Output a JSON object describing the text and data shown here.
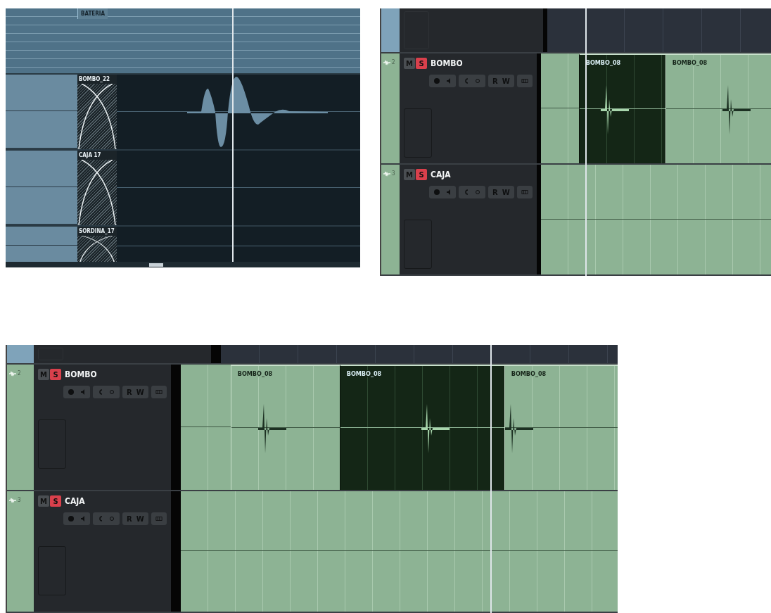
{
  "panels": [
    {
      "kind": "folder",
      "folder": {
        "label": "BATERIA"
      },
      "lanes": [
        {
          "label": "BOMBO_22",
          "waveform": true
        },
        {
          "label": "CAJA 17",
          "waveform": false
        },
        {
          "label": "SORDINA_17",
          "waveform": false
        }
      ]
    },
    {
      "kind": "tracks",
      "tracks": [
        {
          "number": "2",
          "mute": {
            "label": "M",
            "on": false
          },
          "solo": {
            "label": "S",
            "on": true
          },
          "name": "BOMBO",
          "read": "R",
          "write": "W",
          "clips": [
            {
              "label": "BOMBO_08",
              "selected": true
            },
            {
              "label": "BOMBO_08",
              "selected": false
            }
          ]
        },
        {
          "number": "3",
          "mute": {
            "label": "M",
            "on": false
          },
          "solo": {
            "label": "S",
            "on": true
          },
          "name": "CAJA",
          "read": "R",
          "write": "W"
        }
      ]
    },
    {
      "kind": "tracks",
      "tracks": [
        {
          "number": "2",
          "mute": {
            "label": "M",
            "on": false
          },
          "solo": {
            "label": "S",
            "on": true
          },
          "name": "BOMBO",
          "read": "R",
          "write": "W",
          "clips": [
            {
              "label": "BOMBO_08",
              "selected": false
            },
            {
              "label": "BOMBO_08",
              "selected": true
            },
            {
              "label": "BOMBO_08",
              "selected": false
            }
          ]
        },
        {
          "number": "3",
          "mute": {
            "label": "M",
            "on": false
          },
          "solo": {
            "label": "S",
            "on": true
          },
          "name": "CAJA",
          "read": "R",
          "write": "W"
        }
      ]
    }
  ]
}
